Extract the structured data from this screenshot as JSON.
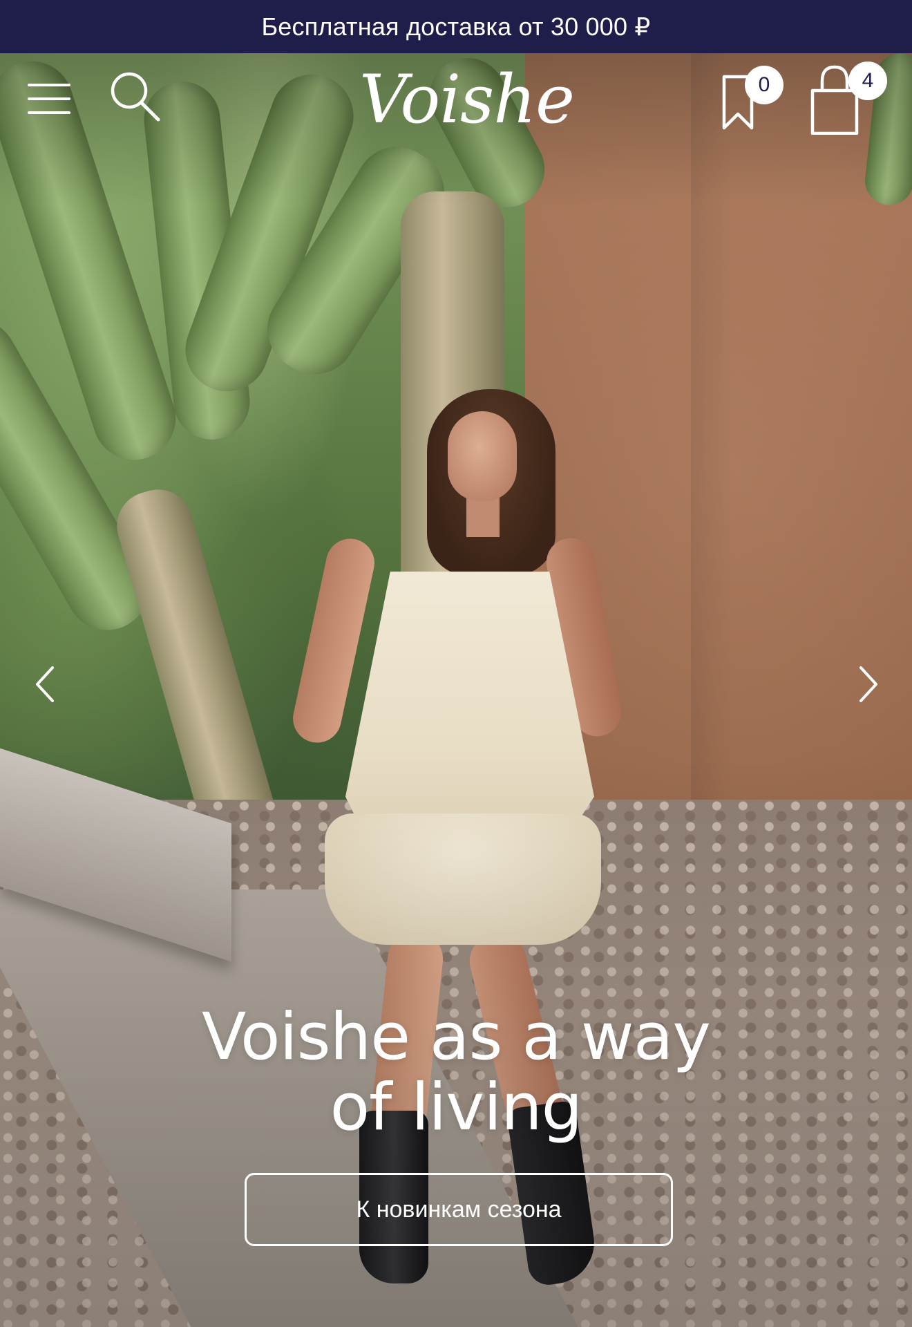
{
  "promo_bar": {
    "text": "Бесплатная доставка от 30 000 ₽"
  },
  "header": {
    "logo": "Voishe",
    "favorites_count": "0",
    "cart_count": "4",
    "icons": {
      "menu": "hamburger-menu-icon",
      "search": "search-icon",
      "favorites": "bookmark-icon",
      "cart": "shopping-bag-icon"
    }
  },
  "hero": {
    "headline_line1": "Voishe as a way",
    "headline_line2": "of living",
    "cta_label": "К новинкам сезона",
    "prev_icon": "chevron-left-icon",
    "next_icon": "chevron-right-icon"
  },
  "colors": {
    "promo_background": "#1f1d4a",
    "text_light": "#ffffff",
    "badge_background": "#ffffff",
    "badge_text": "#1f1d4a"
  }
}
